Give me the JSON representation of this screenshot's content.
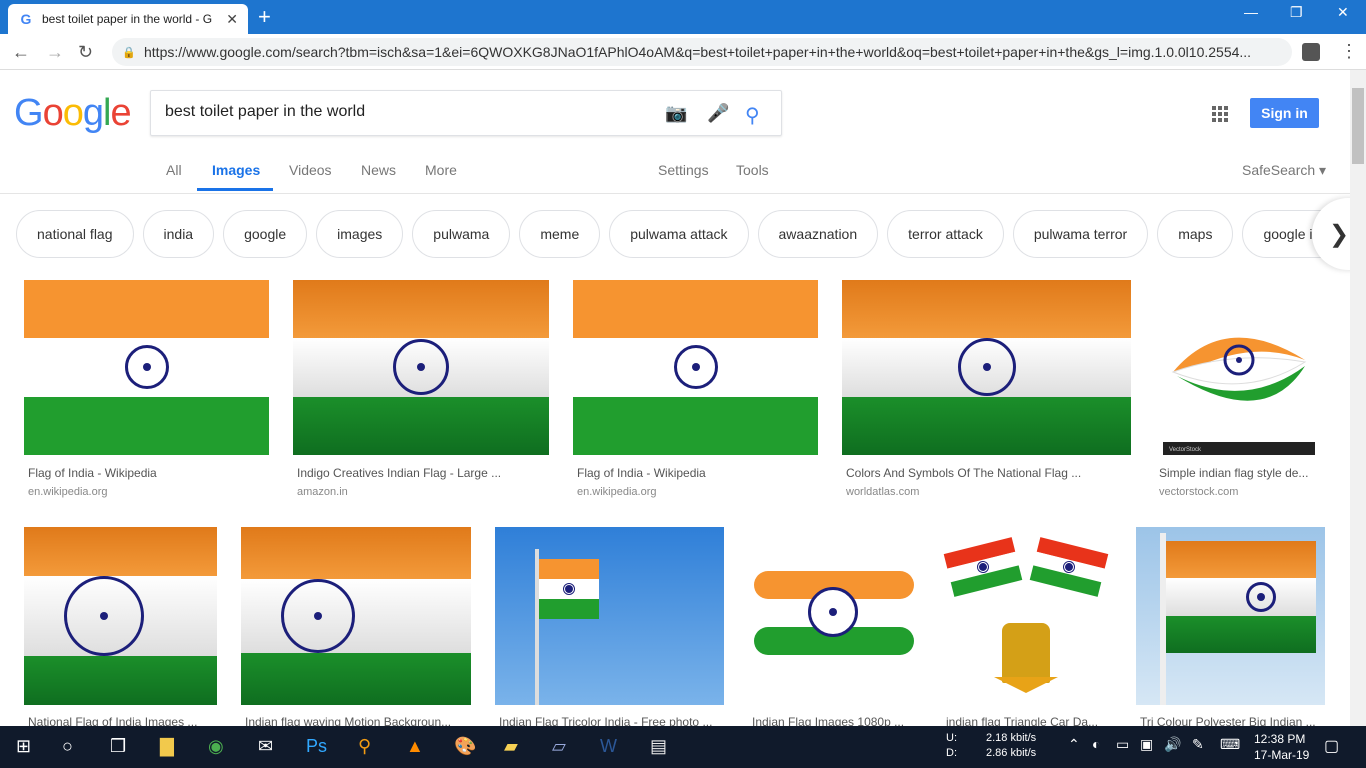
{
  "browser": {
    "tab_title": "best toilet paper in the world - G",
    "new_tab": "+",
    "url": "https://www.google.com/search?tbm=isch&sa=1&ei=6QWOXKG8JNaO1fAPhlO4oAM&q=best+toilet+paper+in+the+world&oq=best+toilet+paper+in+the&gs_l=img.1.0.0l10.2554..."
  },
  "google": {
    "logo_letters": [
      "G",
      "o",
      "o",
      "g",
      "l",
      "e"
    ],
    "search_value": "best toilet paper in the world",
    "signin": "Sign in",
    "tabs": [
      "All",
      "Images",
      "Videos",
      "News",
      "More"
    ],
    "settings": "Settings",
    "tools": "Tools",
    "safesearch": "SafeSearch ▾"
  },
  "chips": [
    "national flag",
    "india",
    "google",
    "images",
    "pulwama",
    "meme",
    "pulwama attack",
    "awaaznation",
    "terror attack",
    "pulwama terror",
    "maps",
    "google im"
  ],
  "results": [
    {
      "caption": "Flag of India - Wikipedia",
      "domain": "en.wikipedia.org"
    },
    {
      "caption": "Indigo Creatives Indian Flag - Large ...",
      "domain": "amazon.in"
    },
    {
      "caption": "Flag of India - Wikipedia",
      "domain": "en.wikipedia.org"
    },
    {
      "caption": "Colors And Symbols Of The National Flag ...",
      "domain": "worldatlas.com"
    },
    {
      "caption": "Simple indian flag style de...",
      "domain": "vectorstock.com"
    },
    {
      "caption": "National Flag of India Images ...",
      "domain": ""
    },
    {
      "caption": "Indian flag waving Motion Backgroun...",
      "domain": ""
    },
    {
      "caption": "Indian Flag Tricolor India - Free photo ...",
      "domain": ""
    },
    {
      "caption": "Indian Flag Images 1080p ...",
      "domain": ""
    },
    {
      "caption": "indian flag Triangle Car Da...",
      "domain": ""
    },
    {
      "caption": "Tri Colour Polyester Big Indian ...",
      "domain": ""
    }
  ],
  "vectorstock_badge": "VectorStock",
  "taskbar": {
    "net_up_label": "U:",
    "net_up": "2.18 kbit/s",
    "net_down_label": "D:",
    "net_down": "2.86 kbit/s",
    "time": "12:38 PM",
    "date": "17-Mar-19"
  },
  "colors": {
    "accent": "#1a73e8",
    "signin": "#4285f4",
    "saffron": "#f69430",
    "green": "#219e2e",
    "navy": "#1c1f7a"
  }
}
